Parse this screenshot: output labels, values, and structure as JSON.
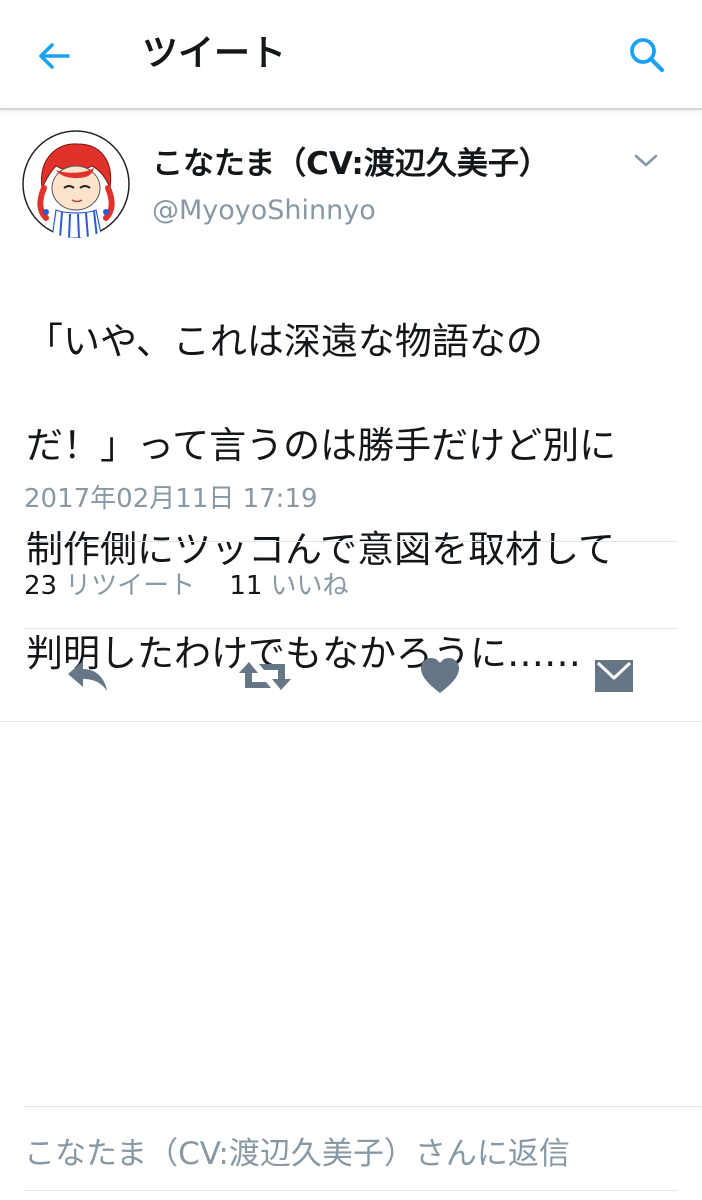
{
  "header": {
    "title": "ツイート",
    "back_icon": "back-arrow-icon",
    "search_icon": "search-icon",
    "accent_color": "#1da1f2"
  },
  "tweet": {
    "display_name": "こなたま（CV:渡辺久美子）",
    "handle": "@MyoyoShinnyo",
    "text_lines": [
      "「いや、これは深遠な物語なの",
      "だ！」って言うのは勝手だけど別に",
      "制作側にツッコんで意図を取材して",
      "判明したわけでもなかろうに……"
    ],
    "timestamp": "2017年02月11日 17:19"
  },
  "stats": {
    "retweets_count": "23",
    "retweets_label": "リツイート",
    "likes_count": "11",
    "likes_label": "いいね"
  },
  "actions": {
    "icons": [
      "reply-icon",
      "retweet-icon",
      "like-icon",
      "direct-message-icon"
    ],
    "icon_color": "#657786"
  },
  "reply_bar": {
    "placeholder": "こなたま（CV:渡辺久美子）さんに返信"
  }
}
